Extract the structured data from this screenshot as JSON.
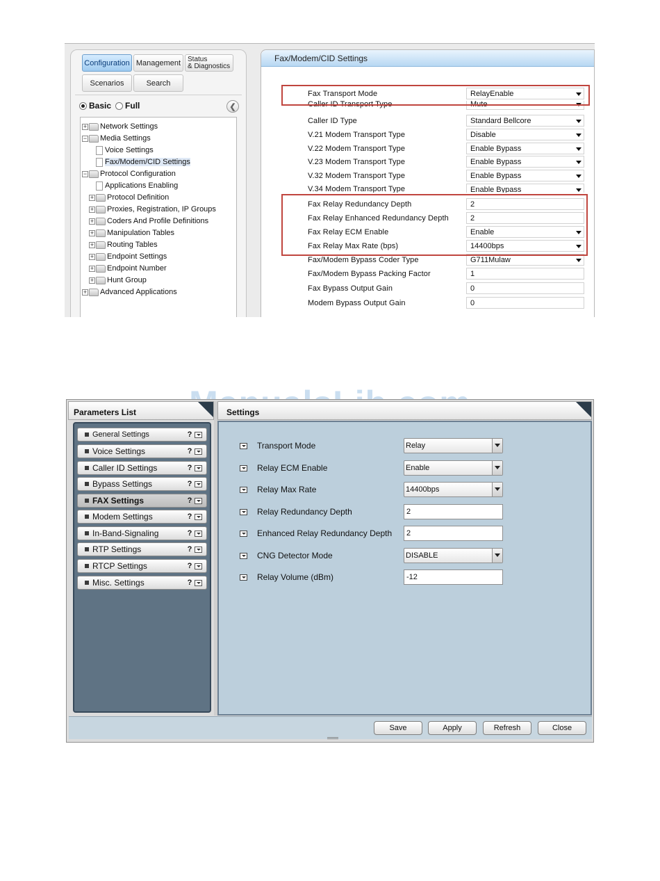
{
  "screenshot1": {
    "nav_buttons": {
      "configuration": "Configuration",
      "management": "Management",
      "status_line1": "Status",
      "status_line2": "& Diagnostics",
      "scenarios": "Scenarios",
      "search": "Search"
    },
    "view_mode": {
      "basic": "Basic",
      "full": "Full",
      "selected": "Basic"
    },
    "tree": [
      {
        "label": "Network Settings",
        "kind": "folder",
        "expandable": true
      },
      {
        "label": "Media Settings",
        "kind": "folder",
        "expandable": true
      },
      {
        "label": "Voice Settings",
        "kind": "page"
      },
      {
        "label": "Fax/Modem/CID Settings",
        "kind": "page",
        "selected": true
      },
      {
        "label": "Protocol Configuration",
        "kind": "folder",
        "expandable": true
      },
      {
        "label": "Applications Enabling",
        "kind": "page"
      },
      {
        "label": "Protocol Definition",
        "kind": "folder",
        "expandable": true
      },
      {
        "label": "Proxies, Registration, IP Groups",
        "kind": "folder",
        "expandable": true
      },
      {
        "label": "Coders And Profile Definitions",
        "kind": "folder",
        "expandable": true
      },
      {
        "label": "Manipulation Tables",
        "kind": "folder",
        "expandable": true
      },
      {
        "label": "Routing Tables",
        "kind": "folder",
        "expandable": true
      },
      {
        "label": "Endpoint Settings",
        "kind": "folder",
        "expandable": true
      },
      {
        "label": "Endpoint Number",
        "kind": "folder",
        "expandable": true
      },
      {
        "label": "Hunt Group",
        "kind": "folder",
        "expandable": true
      },
      {
        "label": "Advanced Applications",
        "kind": "folder",
        "expandable": true
      }
    ],
    "panel_title": "Fax/Modem/CID Settings",
    "params": [
      {
        "label": "Fax Transport Mode",
        "value": "RelayEnable",
        "type": "select"
      },
      {
        "label": "Caller ID Transport Type",
        "value": "Mute",
        "type": "select"
      },
      {
        "label": "Caller ID Type",
        "value": "Standard Bellcore",
        "type": "select"
      },
      {
        "label": "V.21 Modem Transport Type",
        "value": "Disable",
        "type": "select"
      },
      {
        "label": "V.22 Modem Transport Type",
        "value": "Enable Bypass",
        "type": "select"
      },
      {
        "label": "V.23 Modem Transport Type",
        "value": "Enable Bypass",
        "type": "select"
      },
      {
        "label": "V.32 Modem Transport Type",
        "value": "Enable Bypass",
        "type": "select"
      },
      {
        "label": "V.34 Modem Transport Type",
        "value": "Enable Bypass",
        "type": "select"
      },
      {
        "label": "Fax Relay Redundancy Depth",
        "value": "2",
        "type": "input"
      },
      {
        "label": "Fax Relay Enhanced Redundancy Depth",
        "value": "2",
        "type": "input"
      },
      {
        "label": "Fax Relay ECM Enable",
        "value": "Enable",
        "type": "select"
      },
      {
        "label": "Fax Relay Max Rate (bps)",
        "value": "14400bps",
        "type": "select"
      },
      {
        "label": "Fax/Modem Bypass Coder Type",
        "value": "G711Mulaw",
        "type": "select"
      },
      {
        "label": "Fax/Modem Bypass Packing Factor",
        "value": "1",
        "type": "input"
      },
      {
        "label": "Fax Bypass Output Gain",
        "value": "0",
        "type": "input"
      },
      {
        "label": "Modem Bypass Output Gain",
        "value": "0",
        "type": "input"
      }
    ],
    "highlight_color": "#c0453e"
  },
  "screenshot2": {
    "parameters_list_title": "Parameters List",
    "settings_title": "Settings",
    "list": [
      {
        "label": "General Settings",
        "help": "?"
      },
      {
        "label": "Voice Settings",
        "help": "?"
      },
      {
        "label": "Caller ID Settings",
        "help": "?"
      },
      {
        "label": "Bypass Settings",
        "help": "?"
      },
      {
        "label": "FAX Settings",
        "help": "?",
        "selected": true
      },
      {
        "label": "Modem Settings",
        "help": "?"
      },
      {
        "label": "In-Band-Signaling",
        "help": "?"
      },
      {
        "label": "RTP Settings",
        "help": "?"
      },
      {
        "label": "RTCP Settings",
        "help": "?"
      },
      {
        "label": "Misc. Settings",
        "help": "?"
      }
    ],
    "fields": [
      {
        "label": "Transport Mode",
        "value": "Relay",
        "type": "select"
      },
      {
        "label": "Relay ECM Enable",
        "value": "Enable",
        "type": "select"
      },
      {
        "label": "Relay Max Rate",
        "value": "14400bps",
        "type": "select"
      },
      {
        "label": "Relay Redundancy Depth",
        "value": "2",
        "type": "input"
      },
      {
        "label": "Enhanced Relay Redundancy Depth",
        "value": "2",
        "type": "input"
      },
      {
        "label": "CNG Detector Mode",
        "value": "DISABLE",
        "type": "select"
      },
      {
        "label": "Relay Volume (dBm)",
        "value": "-12",
        "type": "input"
      }
    ],
    "buttons": {
      "save": "Save",
      "apply": "Apply",
      "refresh": "Refresh",
      "close": "Close"
    }
  },
  "watermark": "ManualsLib.com"
}
